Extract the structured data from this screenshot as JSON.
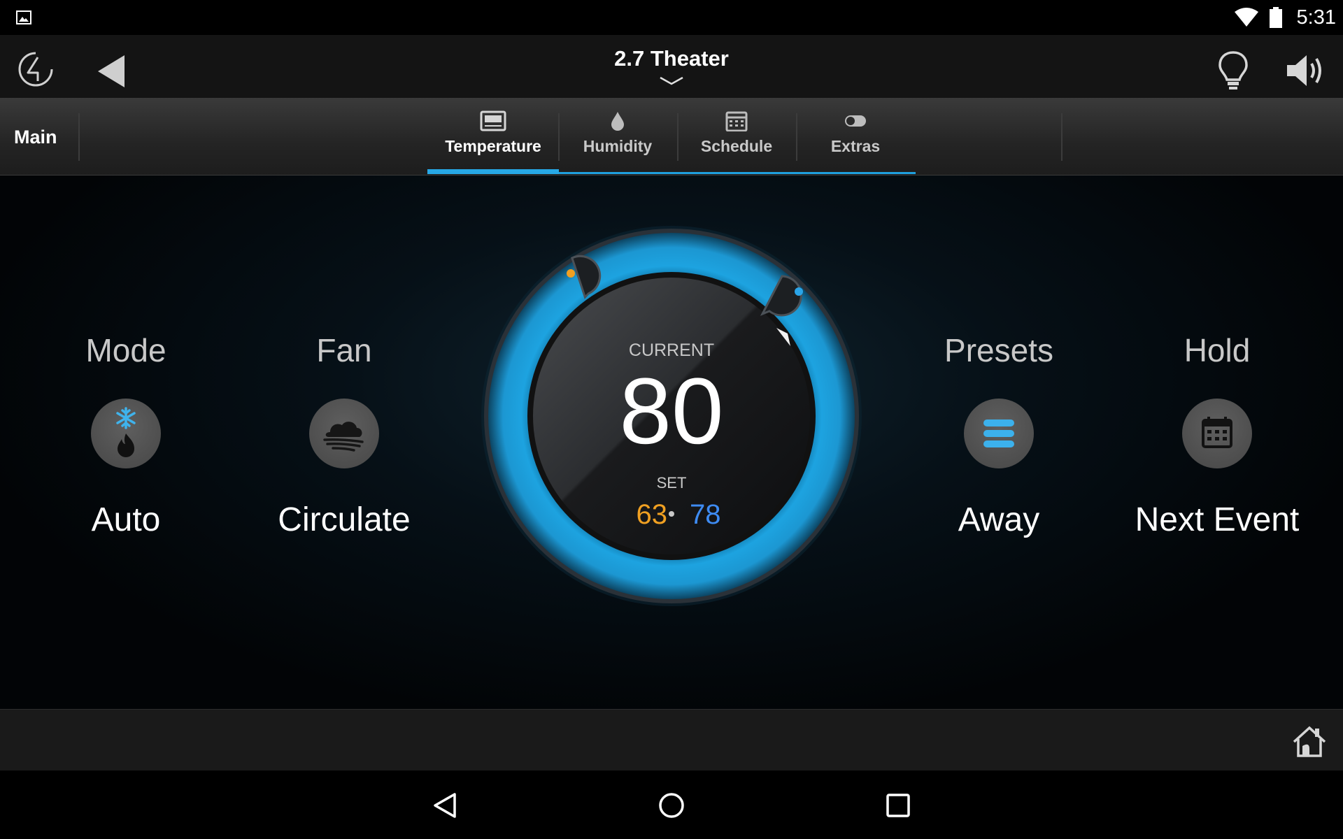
{
  "status_bar": {
    "time": "5:31",
    "icons": [
      "gallery-notification-icon",
      "wifi-icon",
      "battery-icon"
    ]
  },
  "header": {
    "title": "2.7 Theater",
    "icons": [
      "control4-logo-icon",
      "back-arrow-icon",
      "chevron-down-icon",
      "lightbulb-icon",
      "speaker-icon"
    ]
  },
  "tabs": {
    "main_label": "Main",
    "items": [
      {
        "label": "Temperature",
        "icon": "thermostat-icon",
        "active": true
      },
      {
        "label": "Humidity",
        "icon": "droplet-icon",
        "active": false
      },
      {
        "label": "Schedule",
        "icon": "calendar-icon",
        "active": false
      },
      {
        "label": "Extras",
        "icon": "toggle-icon",
        "active": false
      }
    ]
  },
  "controls": {
    "mode": {
      "title": "Mode",
      "value": "Auto",
      "icon": "snowflake-flame-icon"
    },
    "fan": {
      "title": "Fan",
      "value": "Circulate",
      "icon": "fan-wind-icon"
    },
    "presets": {
      "title": "Presets",
      "value": "Away",
      "icon": "list-icon"
    },
    "hold": {
      "title": "Hold",
      "value": "Next Event",
      "icon": "calendar-icon"
    }
  },
  "thermostat": {
    "current_label": "CURRENT",
    "current_temp": "80",
    "set_label": "SET",
    "heat_setpoint": "63",
    "cool_setpoint": "78",
    "heat_color": "#f0a022",
    "cool_color": "#3e8bf2",
    "ring_color": "#1da3e0"
  },
  "colors": {
    "accent": "#27a8e6"
  },
  "bottom_bar": {
    "icons": [
      "room-home-icon"
    ]
  },
  "nav_bar": {
    "icons": [
      "nav-back-icon",
      "nav-home-icon",
      "nav-recents-icon"
    ]
  }
}
